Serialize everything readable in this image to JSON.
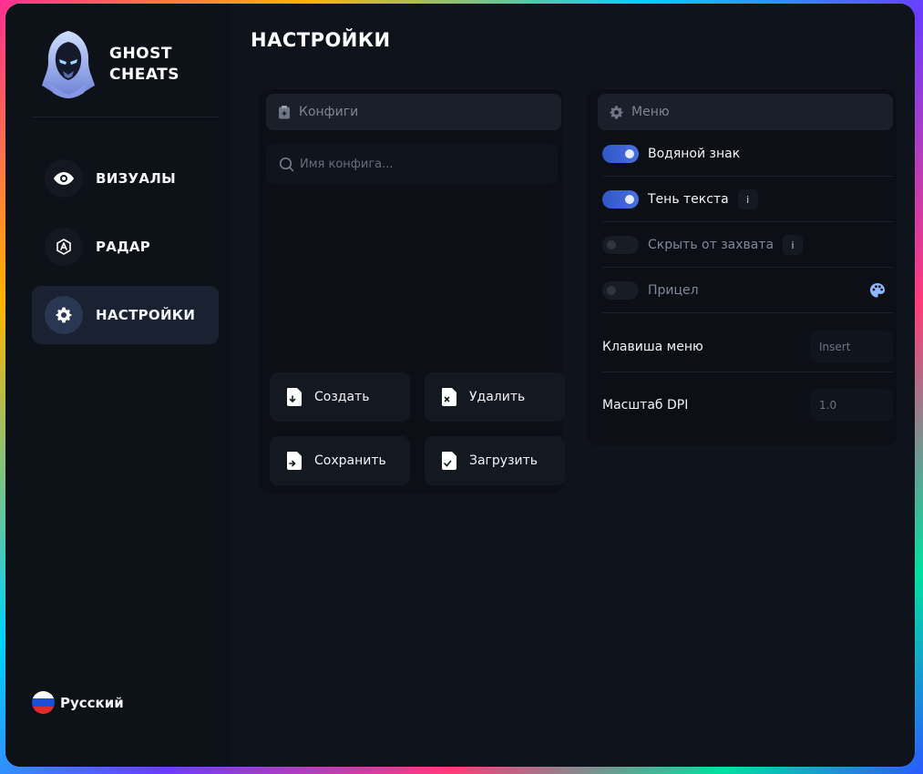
{
  "brand": {
    "line1": "GHOST",
    "line2": "CHEATS"
  },
  "nav": {
    "items": [
      {
        "label": "ВИЗУАЛЫ",
        "icon": "eye-icon"
      },
      {
        "label": "РАДАР",
        "icon": "radar-icon"
      },
      {
        "label": "НАСТРОЙКИ",
        "icon": "gear-icon",
        "active": true
      }
    ]
  },
  "language": {
    "label": "Русский"
  },
  "page": {
    "title": "НАСТРОЙКИ"
  },
  "configs": {
    "header": "Конфиги",
    "search_placeholder": "Имя конфига...",
    "buttons": {
      "create": "Создать",
      "delete": "Удалить",
      "save": "Сохранить",
      "load": "Загрузить"
    }
  },
  "menu": {
    "header": "Меню",
    "toggles": [
      {
        "label": "Водяной знак",
        "on": true
      },
      {
        "label": "Тень текста",
        "on": true,
        "info": "i"
      },
      {
        "label": "Скрыть от захвата",
        "on": false,
        "info": "i"
      },
      {
        "label": "Прицел",
        "on": false
      }
    ],
    "menu_key": {
      "label": "Клавиша меню",
      "value": "Insert"
    },
    "dpi": {
      "label": "Масштаб DPI",
      "value": "1.0"
    }
  },
  "colors": {
    "accent": "#3d63d6",
    "background": "#0f131b",
    "panel": "#0c0f16"
  }
}
